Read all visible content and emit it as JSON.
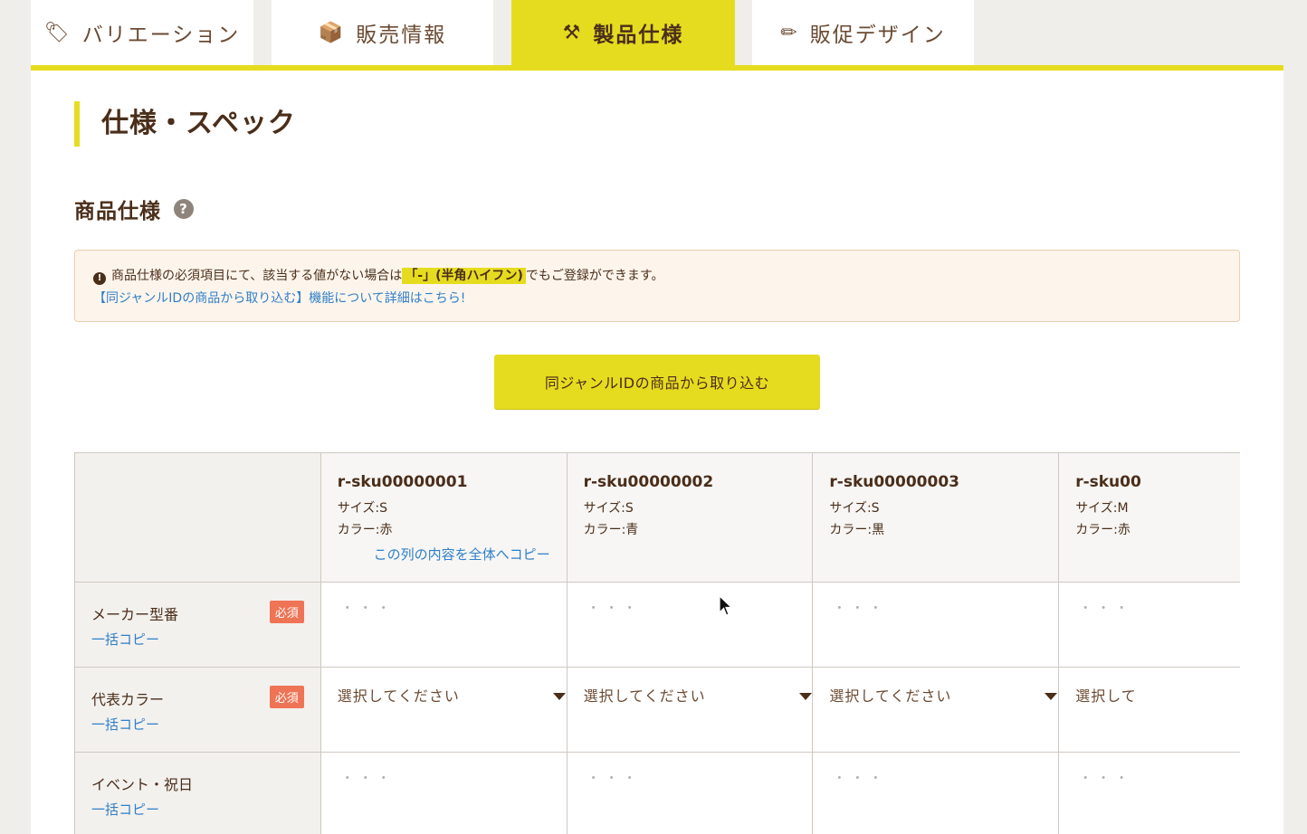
{
  "tabs": [
    {
      "label": "バリエーション",
      "icon": "tag-icon",
      "glyph": "🏷"
    },
    {
      "label": "販売情報",
      "icon": "package-icon",
      "glyph": "📦"
    },
    {
      "label": "製品仕様",
      "icon": "tools-icon",
      "glyph": "⚒"
    },
    {
      "label": "販促デザイン",
      "icon": "pencil-icon",
      "glyph": "✏"
    }
  ],
  "active_tab": "製品仕様",
  "accent_color": "#e6dc1f",
  "page_title": "仕様・スペック",
  "section_title": "商品仕様",
  "help_glyph": "?",
  "notice": {
    "text_before": "商品仕様の必須項目にて、該当する値がない場合は",
    "highlight": "「-」(半角ハイフン)",
    "text_after": "でもご登録ができます。",
    "link": "【同ジャンルIDの商品から取り込む】機能について詳細はこちら!",
    "icon_glyph": "!"
  },
  "import_button": "同ジャンルIDの商品から取り込む",
  "columns": [
    {
      "sku": "r-sku00000001",
      "size": "サイズ:S",
      "color": "カラー:赤"
    },
    {
      "sku": "r-sku00000002",
      "size": "サイズ:S",
      "color": "カラー:青"
    },
    {
      "sku": "r-sku00000003",
      "size": "サイズ:S",
      "color": "カラー:黒"
    },
    {
      "sku": "r-sku00",
      "size": "サイズ:M",
      "color": "カラー:赤"
    }
  ],
  "copy_column_label": "この列の内容を全体へコピー",
  "rows": [
    {
      "label": "メーカー型番",
      "required": "必須",
      "bulk": "一括コピー"
    },
    {
      "label": "代表カラー",
      "required": "必須",
      "bulk": "一括コピー"
    },
    {
      "label": "イベント・祝日",
      "bulk": "一括コピー"
    }
  ],
  "placeholder_dots": "・・・",
  "select_placeholder": "選択してください",
  "select_placeholder_cut": "選択して"
}
